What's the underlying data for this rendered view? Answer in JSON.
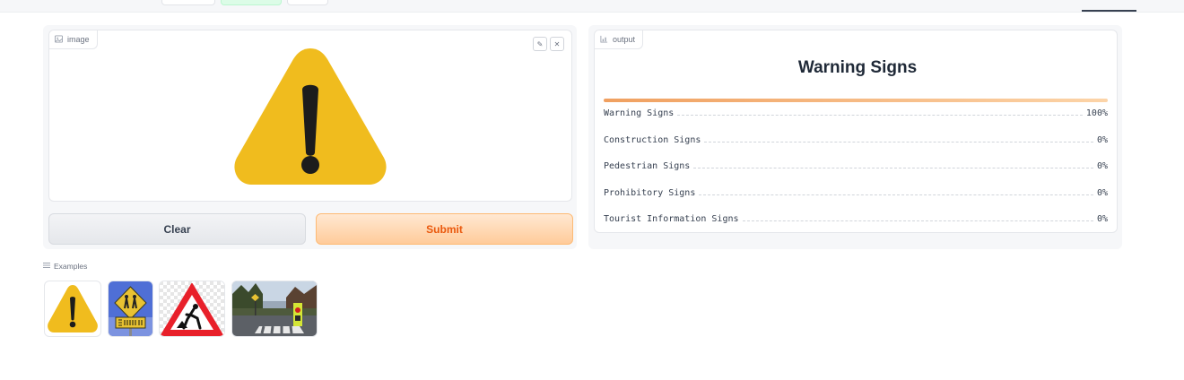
{
  "image_panel": {
    "label": "image",
    "edit_icon": "pencil-icon",
    "close_icon": "close-icon"
  },
  "actions": {
    "clear_label": "Clear",
    "submit_label": "Submit"
  },
  "output_panel": {
    "label": "output",
    "top_label": "Warning Signs",
    "confidences": [
      {
        "label": "Warning Signs",
        "value": "100%",
        "fraction": 1.0
      },
      {
        "label": "Construction Signs",
        "value": "0%",
        "fraction": 0.0
      },
      {
        "label": "Pedestrian Signs",
        "value": "0%",
        "fraction": 0.0
      },
      {
        "label": "Prohibitory Signs",
        "value": "0%",
        "fraction": 0.0
      },
      {
        "label": "Tourist Information Signs",
        "value": "0%",
        "fraction": 0.0
      }
    ]
  },
  "examples": {
    "label": "Examples",
    "items": [
      "warning-sign-example",
      "school-crossing-sign-example",
      "roadworks-sign-example",
      "street-photo-example"
    ]
  },
  "colors": {
    "accent": "#f97316",
    "warning_yellow": "#f0bc1e",
    "sign_red": "#e8202a"
  }
}
